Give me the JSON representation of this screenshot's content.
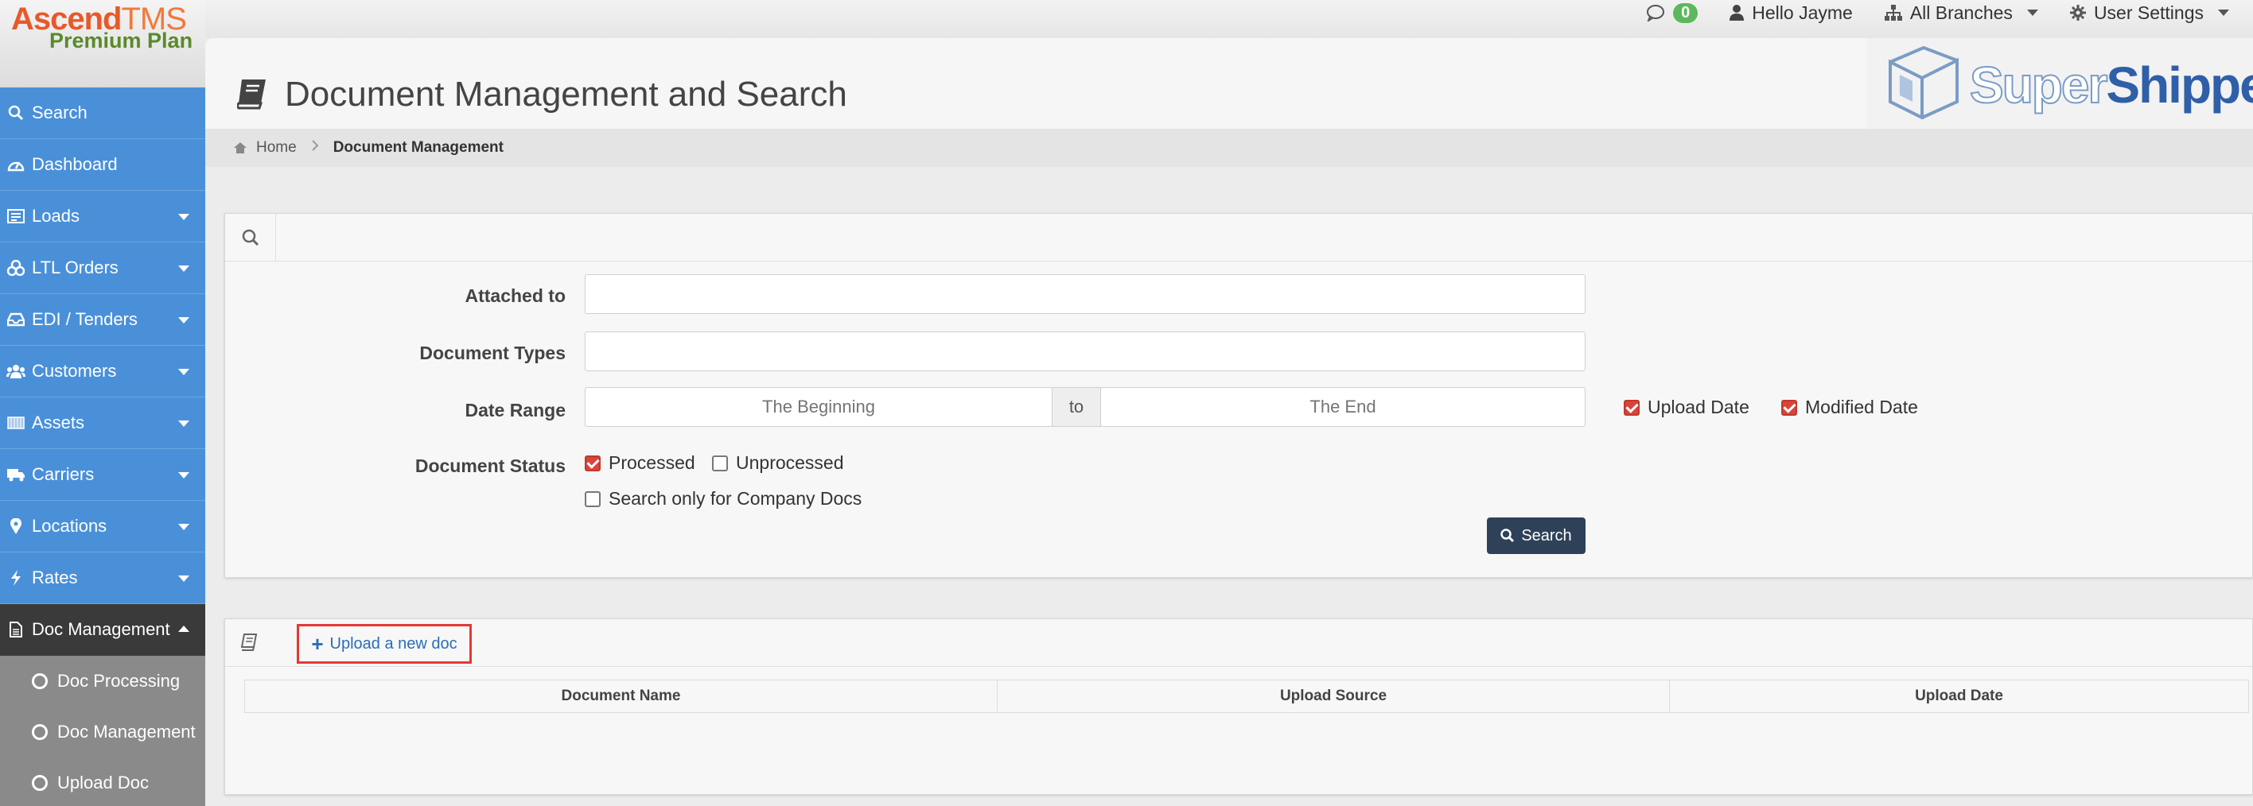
{
  "brand": {
    "name_a": "Ascend",
    "name_b": "TMS",
    "plan": "Premium Plan"
  },
  "topnav": {
    "messages_count": "0",
    "greeting": "Hello Jayme",
    "branches": "All Branches",
    "user_settings": "User Settings"
  },
  "sidebar": {
    "items": [
      {
        "label": "Search",
        "icon": "search-icon"
      },
      {
        "label": "Dashboard",
        "icon": "dashboard-icon"
      },
      {
        "label": "Loads",
        "icon": "loads-icon"
      },
      {
        "label": "LTL Orders",
        "icon": "ltl-icon"
      },
      {
        "label": "EDI / Tenders",
        "icon": "inbox-icon"
      },
      {
        "label": "Customers",
        "icon": "users-icon"
      },
      {
        "label": "Assets",
        "icon": "assets-icon"
      },
      {
        "label": "Carriers",
        "icon": "truck-icon"
      },
      {
        "label": "Locations",
        "icon": "map-marker-icon"
      },
      {
        "label": "Rates",
        "icon": "bolt-icon"
      },
      {
        "label": "Doc Management",
        "icon": "document-icon"
      }
    ],
    "subitems": [
      {
        "label": "Doc Processing"
      },
      {
        "label": "Doc Management"
      },
      {
        "label": "Upload Doc"
      }
    ]
  },
  "page": {
    "title": "Document Management and Search",
    "logo_super": "Super",
    "logo_shipper": "Shipper"
  },
  "breadcrumb": {
    "home": "Home",
    "current": "Document Management"
  },
  "search_form": {
    "attached_to_label": "Attached to",
    "attached_to_value": "",
    "document_types_label": "Document Types",
    "document_types_value": "",
    "date_range_label": "Date Range",
    "date_from_placeholder": "The Beginning",
    "date_to_text": "to",
    "date_to_placeholder": "The End",
    "upload_date_label": "Upload Date",
    "modified_date_label": "Modified Date",
    "document_status_label": "Document Status",
    "processed_label": "Processed",
    "unprocessed_label": "Unprocessed",
    "company_docs_label": "Search only for Company Docs",
    "search_button": "Search"
  },
  "documents": {
    "upload_link": "Upload a new doc",
    "columns": [
      "Document Name",
      "Upload Source",
      "Upload Date"
    ]
  },
  "colors": {
    "sidebar_blue": "#4a90d9",
    "button_dark": "#2e4158",
    "check_red": "#d9443c",
    "highlight_red": "#e53935"
  }
}
